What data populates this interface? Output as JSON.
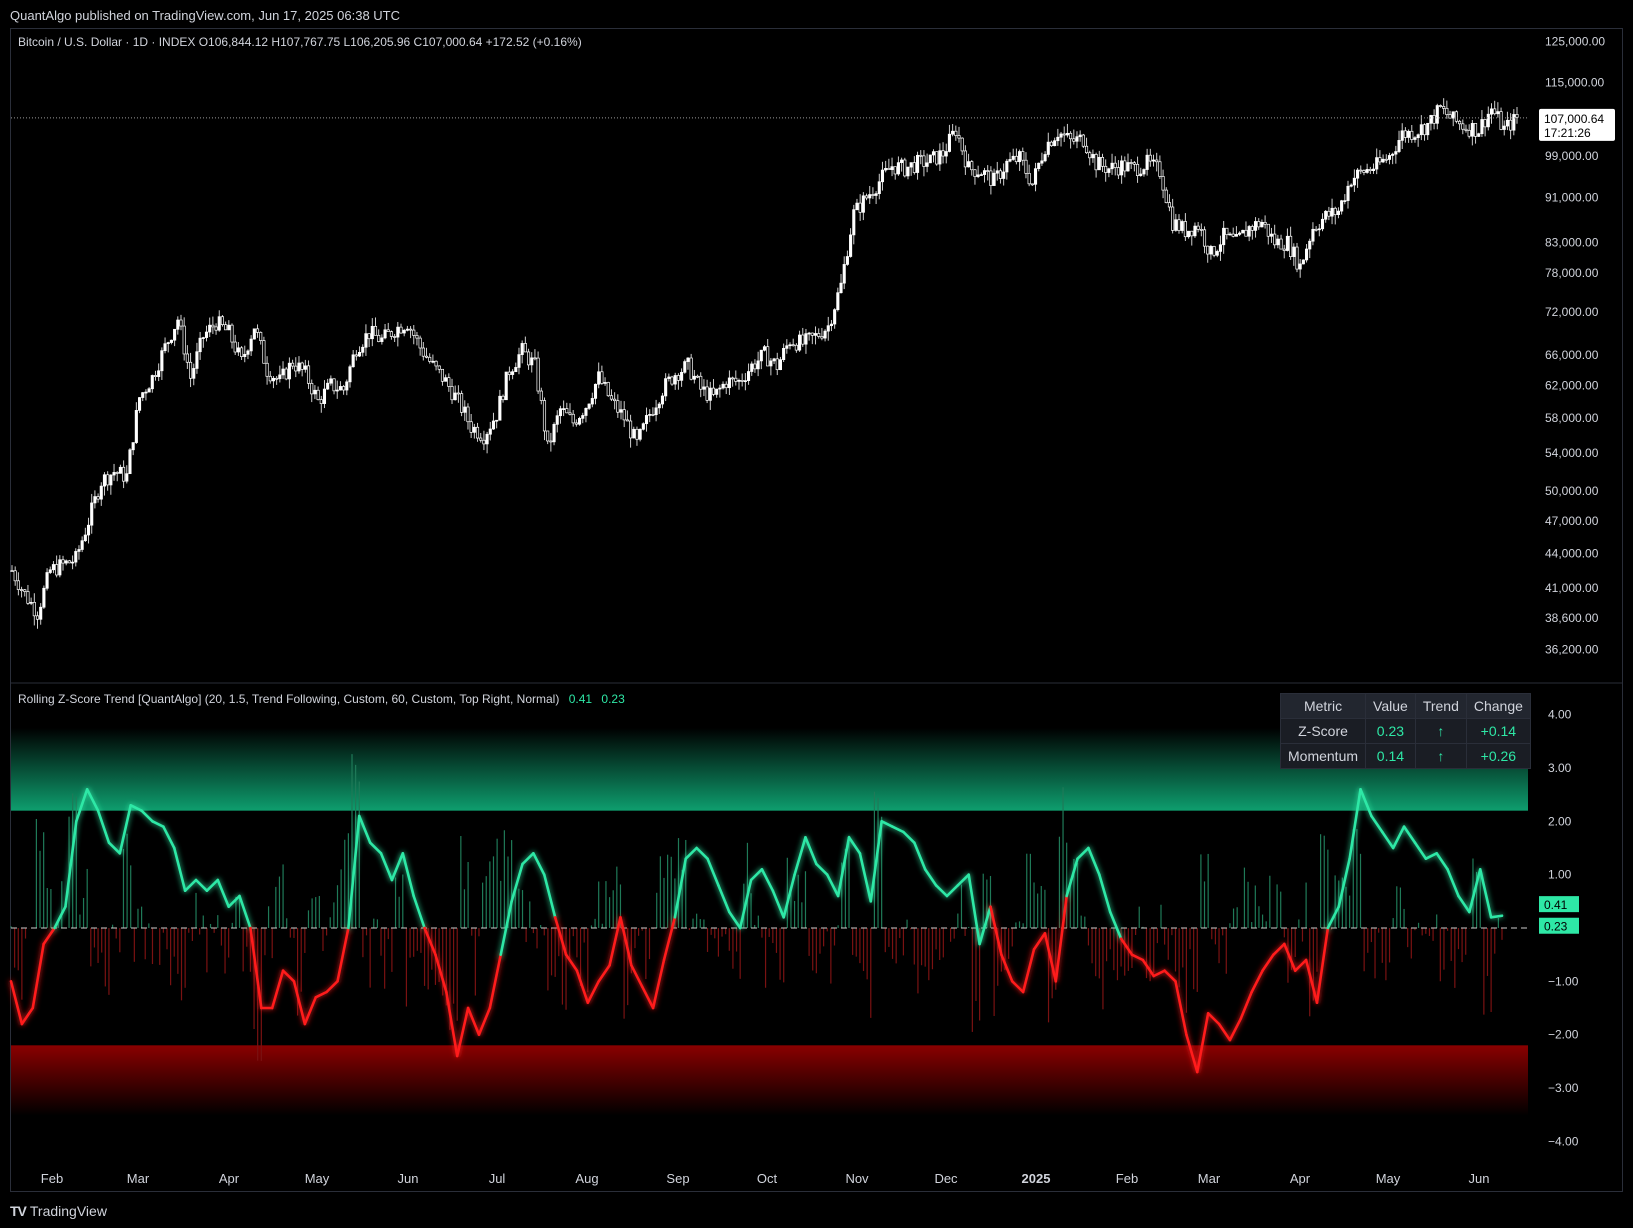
{
  "header": {
    "published": "QuantAlgo published on TradingView.com, Jun 17, 2025 06:38 UTC"
  },
  "price_panel": {
    "legend": "Bitcoin / U.S. Dollar · 1D · INDEX  O106,844.12  H107,767.75  L106,205.96  C107,000.64  +172.52 (+0.16%)",
    "last_price_label": "107,000.64",
    "countdown_label": "17:21:26"
  },
  "indicator_panel": {
    "legend": "Rolling Z-Score Trend [QuantAlgo] (20, 1.5, Trend Following, Custom, 60, Custom, Top Right, Normal)",
    "legend_value1": "0.41",
    "legend_value2": "0.23",
    "tag_value1": "0.41",
    "tag_value2": "0.23"
  },
  "metrics_table": {
    "headers": [
      "Metric",
      "Value",
      "Trend",
      "Change"
    ],
    "rows": [
      {
        "metric": "Z-Score",
        "value": "0.23",
        "trend": "↑",
        "change": "+0.14"
      },
      {
        "metric": "Momentum",
        "value": "0.14",
        "trend": "↑",
        "change": "+0.26"
      }
    ]
  },
  "footer": {
    "brand": "TradingView"
  },
  "colors": {
    "background": "#000000",
    "bull": "#2ee8a6",
    "bear": "#ff1a1a",
    "text": "#d1d4dc"
  },
  "chart_data": [
    {
      "type": "candlestick",
      "title": "Bitcoin / U.S. Dollar · 1D · INDEX",
      "scale": "log",
      "ylim": [
        34000,
        128000
      ],
      "y_ticks": [
        {
          "value": 125000,
          "label": "125,000.00"
        },
        {
          "value": 115000,
          "label": "115,000.00"
        },
        {
          "value": 99000,
          "label": "99,000.00"
        },
        {
          "value": 91000,
          "label": "91,000.00"
        },
        {
          "value": 83000,
          "label": "83,000.00"
        },
        {
          "value": 78000,
          "label": "78,000.00"
        },
        {
          "value": 72000,
          "label": "72,000.00"
        },
        {
          "value": 66000,
          "label": "66,000.00"
        },
        {
          "value": 62000,
          "label": "62,000.00"
        },
        {
          "value": 58000,
          "label": "58,000.00"
        },
        {
          "value": 54000,
          "label": "54,000.00"
        },
        {
          "value": 50000,
          "label": "50,000.00"
        },
        {
          "value": 47000,
          "label": "47,000.00"
        },
        {
          "value": 44000,
          "label": "44,000.00"
        },
        {
          "value": 41000,
          "label": "41,000.00"
        },
        {
          "value": 38600,
          "label": "38,600.00"
        },
        {
          "value": 36200,
          "label": "36,200.00"
        }
      ],
      "x_ticks": [
        "Feb",
        "Mar",
        "Apr",
        "May",
        "Jun",
        "Jul",
        "Aug",
        "Sep",
        "Oct",
        "Nov",
        "Dec",
        "2025",
        "Feb",
        "Mar",
        "Apr",
        "May",
        "Jun"
      ],
      "close_path": [
        [
          0,
          42500
        ],
        [
          4,
          40500
        ],
        [
          8,
          39000
        ],
        [
          12,
          42500
        ],
        [
          16,
          43000
        ],
        [
          20,
          43500
        ],
        [
          24,
          47000
        ],
        [
          28,
          51000
        ],
        [
          32,
          52000
        ],
        [
          36,
          51500
        ],
        [
          40,
          60500
        ],
        [
          44,
          63000
        ],
        [
          48,
          67000
        ],
        [
          52,
          71000
        ],
        [
          56,
          63000
        ],
        [
          60,
          68500
        ],
        [
          64,
          70500
        ],
        [
          68,
          69000
        ],
        [
          72,
          65000
        ],
        [
          76,
          70000
        ],
        [
          80,
          64000
        ],
        [
          84,
          62500
        ],
        [
          88,
          65000
        ],
        [
          92,
          63500
        ],
        [
          96,
          60000
        ],
        [
          100,
          62000
        ],
        [
          104,
          61500
        ],
        [
          108,
          67000
        ],
        [
          112,
          69000
        ],
        [
          116,
          68000
        ],
        [
          120,
          69500
        ],
        [
          124,
          70500
        ],
        [
          128,
          67000
        ],
        [
          132,
          64500
        ],
        [
          136,
          62500
        ],
        [
          140,
          60000
        ],
        [
          144,
          57000
        ],
        [
          148,
          56000
        ],
        [
          152,
          58500
        ],
        [
          156,
          64000
        ],
        [
          160,
          66500
        ],
        [
          164,
          64500
        ],
        [
          168,
          54500
        ],
        [
          172,
          59000
        ],
        [
          176,
          57500
        ],
        [
          180,
          59500
        ],
        [
          184,
          63000
        ],
        [
          188,
          60000
        ],
        [
          192,
          58000
        ],
        [
          196,
          55000
        ],
        [
          200,
          58500
        ],
        [
          204,
          61500
        ],
        [
          208,
          63500
        ],
        [
          212,
          64500
        ],
        [
          216,
          61500
        ],
        [
          220,
          60500
        ],
        [
          224,
          62500
        ],
        [
          228,
          62500
        ],
        [
          232,
          64500
        ],
        [
          236,
          66000
        ],
        [
          240,
          64500
        ],
        [
          244,
          68000
        ],
        [
          248,
          67500
        ],
        [
          252,
          68500
        ],
        [
          256,
          70000
        ],
        [
          260,
          76000
        ],
        [
          264,
          88000
        ],
        [
          268,
          91000
        ],
        [
          272,
          94000
        ],
        [
          276,
          97000
        ],
        [
          280,
          96500
        ],
        [
          284,
          97500
        ],
        [
          288,
          98000
        ],
        [
          292,
          99500
        ],
        [
          296,
          104500
        ],
        [
          300,
          96500
        ],
        [
          304,
          96000
        ],
        [
          308,
          94000
        ],
        [
          312,
          97500
        ],
        [
          316,
          98500
        ],
        [
          320,
          93500
        ],
        [
          324,
          101000
        ],
        [
          328,
          104000
        ],
        [
          332,
          102000
        ],
        [
          336,
          102500
        ],
        [
          340,
          97500
        ],
        [
          344,
          96500
        ],
        [
          348,
          97000
        ],
        [
          352,
          96500
        ],
        [
          356,
          97500
        ],
        [
          360,
          96000
        ],
        [
          364,
          86500
        ],
        [
          368,
          85000
        ],
        [
          372,
          86000
        ],
        [
          376,
          81000
        ],
        [
          380,
          84000
        ],
        [
          384,
          83000
        ],
        [
          388,
          85500
        ],
        [
          392,
          86500
        ],
        [
          396,
          83000
        ],
        [
          400,
          83000
        ],
        [
          404,
          79000
        ],
        [
          408,
          85500
        ],
        [
          412,
          87500
        ],
        [
          416,
          88500
        ],
        [
          420,
          94500
        ],
        [
          424,
          96000
        ],
        [
          428,
          97000
        ],
        [
          432,
          99000
        ],
        [
          436,
          103500
        ],
        [
          440,
          104000
        ],
        [
          444,
          105500
        ],
        [
          448,
          109000
        ],
        [
          452,
          106500
        ],
        [
          456,
          105000
        ],
        [
          460,
          104500
        ],
        [
          464,
          109000
        ],
        [
          468,
          104500
        ],
        [
          472,
          107000
        ]
      ],
      "last_price": 107000.64
    },
    {
      "type": "line",
      "title": "Rolling Z-Score Trend [QuantAlgo]",
      "ylim": [
        -4.5,
        4.5
      ],
      "y_ticks": [
        4,
        3,
        2,
        1,
        -1,
        -2,
        -3,
        -4
      ],
      "upper_band": 2.2,
      "lower_band": -2.2,
      "series": [
        {
          "values": [
            [
              0,
              -1.0
            ],
            [
              3,
              -1.8
            ],
            [
              6,
              -1.5
            ],
            [
              9,
              -0.3
            ],
            [
              12,
              0.0
            ],
            [
              15,
              0.4
            ],
            [
              18,
              2.0
            ],
            [
              21,
              2.6
            ],
            [
              24,
              2.2
            ],
            [
              27,
              1.6
            ],
            [
              30,
              1.4
            ],
            [
              33,
              2.3
            ],
            [
              36,
              2.2
            ],
            [
              39,
              2.0
            ],
            [
              42,
              1.9
            ],
            [
              45,
              1.5
            ],
            [
              48,
              0.7
            ],
            [
              51,
              0.9
            ],
            [
              54,
              0.7
            ],
            [
              57,
              0.9
            ],
            [
              60,
              0.4
            ],
            [
              63,
              0.6
            ],
            [
              66,
              0.0
            ],
            [
              69,
              -1.5
            ],
            [
              72,
              -1.5
            ],
            [
              75,
              -0.8
            ],
            [
              78,
              -1.0
            ],
            [
              81,
              -1.8
            ],
            [
              84,
              -1.3
            ],
            [
              87,
              -1.2
            ],
            [
              90,
              -1.0
            ],
            [
              93,
              0.0
            ],
            [
              96,
              2.1
            ],
            [
              99,
              1.6
            ],
            [
              102,
              1.4
            ],
            [
              105,
              0.9
            ],
            [
              108,
              1.4
            ],
            [
              111,
              0.6
            ],
            [
              114,
              0.0
            ],
            [
              117,
              -0.5
            ],
            [
              120,
              -1.2
            ],
            [
              123,
              -2.4
            ],
            [
              126,
              -1.5
            ],
            [
              129,
              -2.0
            ],
            [
              132,
              -1.5
            ],
            [
              135,
              -0.5
            ],
            [
              138,
              0.5
            ],
            [
              141,
              1.2
            ],
            [
              144,
              1.4
            ],
            [
              147,
              1.0
            ],
            [
              150,
              0.2
            ],
            [
              153,
              -0.5
            ],
            [
              156,
              -0.8
            ],
            [
              159,
              -1.4
            ],
            [
              162,
              -1.0
            ],
            [
              165,
              -0.7
            ],
            [
              168,
              0.2
            ],
            [
              171,
              -0.7
            ],
            [
              174,
              -1.1
            ],
            [
              177,
              -1.5
            ],
            [
              180,
              -0.6
            ],
            [
              183,
              0.2
            ],
            [
              186,
              1.3
            ],
            [
              189,
              1.5
            ],
            [
              192,
              1.3
            ],
            [
              195,
              0.8
            ],
            [
              198,
              0.3
            ],
            [
              201,
              0.0
            ],
            [
              204,
              0.9
            ],
            [
              207,
              1.1
            ],
            [
              210,
              0.7
            ],
            [
              213,
              0.2
            ],
            [
              216,
              1.0
            ],
            [
              219,
              1.7
            ],
            [
              222,
              1.2
            ],
            [
              225,
              1.0
            ],
            [
              228,
              0.6
            ],
            [
              231,
              1.7
            ],
            [
              234,
              1.4
            ],
            [
              237,
              0.5
            ],
            [
              240,
              2.0
            ],
            [
              243,
              1.9
            ],
            [
              246,
              1.8
            ],
            [
              249,
              1.6
            ],
            [
              252,
              1.1
            ],
            [
              255,
              0.8
            ],
            [
              258,
              0.6
            ],
            [
              261,
              0.8
            ],
            [
              264,
              1.0
            ],
            [
              267,
              -0.3
            ],
            [
              270,
              0.4
            ],
            [
              273,
              -0.5
            ],
            [
              276,
              -1.0
            ],
            [
              279,
              -1.2
            ],
            [
              282,
              -0.4
            ],
            [
              285,
              -0.1
            ],
            [
              288,
              -1.0
            ],
            [
              291,
              0.6
            ],
            [
              294,
              1.3
            ],
            [
              297,
              1.5
            ],
            [
              300,
              1.0
            ],
            [
              303,
              0.3
            ],
            [
              306,
              -0.2
            ],
            [
              309,
              -0.5
            ],
            [
              312,
              -0.6
            ],
            [
              315,
              -0.9
            ],
            [
              318,
              -0.8
            ],
            [
              321,
              -1.0
            ],
            [
              324,
              -2.0
            ],
            [
              327,
              -2.7
            ],
            [
              330,
              -1.6
            ],
            [
              333,
              -1.8
            ],
            [
              336,
              -2.1
            ],
            [
              339,
              -1.7
            ],
            [
              342,
              -1.2
            ],
            [
              345,
              -0.8
            ],
            [
              348,
              -0.5
            ],
            [
              351,
              -0.3
            ],
            [
              354,
              -0.8
            ],
            [
              357,
              -0.6
            ],
            [
              360,
              -1.4
            ],
            [
              363,
              0.0
            ],
            [
              366,
              0.4
            ],
            [
              369,
              1.3
            ],
            [
              372,
              2.6
            ],
            [
              375,
              2.1
            ],
            [
              378,
              1.8
            ],
            [
              381,
              1.5
            ],
            [
              384,
              1.9
            ],
            [
              387,
              1.6
            ],
            [
              390,
              1.3
            ],
            [
              393,
              1.4
            ],
            [
              396,
              1.1
            ],
            [
              399,
              0.6
            ],
            [
              402,
              0.3
            ],
            [
              405,
              1.1
            ],
            [
              408,
              0.2
            ],
            [
              411,
              0.23
            ]
          ]
        }
      ]
    }
  ]
}
